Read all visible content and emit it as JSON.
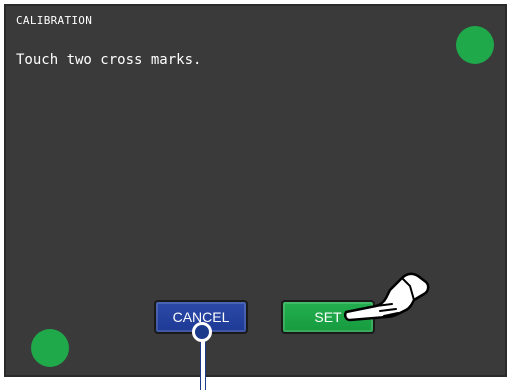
{
  "screen": {
    "title": "CALIBRATION",
    "message": "Touch two cross marks."
  },
  "buttons": {
    "cancel_label": "CANCEL",
    "set_label": "SET"
  },
  "icons": {
    "hand": "pointing-hand-icon",
    "marker": "touch-pointer-icon"
  },
  "colors": {
    "background": "#3a3a3a",
    "marks": "#1fa94b",
    "cancel": "#1e3a96",
    "set": "#179a3f"
  }
}
